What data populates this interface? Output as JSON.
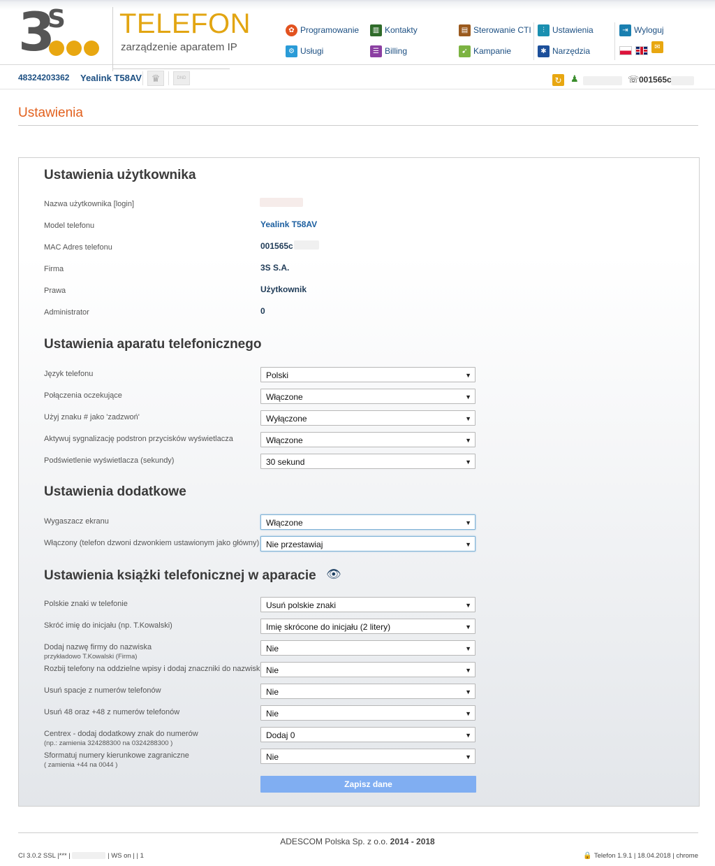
{
  "header": {
    "brand_title": "TELEFON",
    "brand_subtitle": "zarządzenie aparatem IP",
    "nav": {
      "programowanie": "Programowanie",
      "uslugi": "Usługi",
      "kontakty": "Kontakty",
      "billing": "Billing",
      "sterowanie_cti": "Sterowanie CTI",
      "kampanie": "Kampanie",
      "ustawienia": "Ustawienia",
      "narzedzia": "Narzędzia",
      "wyloguj": "Wyloguj"
    },
    "icons": {
      "programowanie": "gear-icon",
      "uslugi": "gear-icon",
      "kontakty": "book-icon",
      "billing": "list-icon",
      "sterowanie_cti": "server-icon",
      "kampanie": "megaphone-icon",
      "ustawienia": "sliders-icon",
      "narzedzia": "tools-icon",
      "wyloguj": "logout-icon"
    },
    "colors": {
      "brand": "#e2a512",
      "nav_link": "#1c4f82"
    }
  },
  "subbar": {
    "phone_number": "48324203362",
    "phone_model": "Yealink T58AV",
    "dnd_label": "DND",
    "mac_prefix": "001565c"
  },
  "page": {
    "title": "Ustawienia",
    "title_color": "#e2611e"
  },
  "user_settings": {
    "title": "Ustawienia użytkownika",
    "rows": [
      {
        "label": "Nazwa użytkownika [login]",
        "value": ""
      },
      {
        "label": "Model telefonu",
        "value": "Yealink T58AV"
      },
      {
        "label": "MAC Adres telefonu",
        "value": "001565c"
      },
      {
        "label": "Firma",
        "value": "3S S.A."
      },
      {
        "label": "Prawa",
        "value": "Użytkownik"
      },
      {
        "label": "Administrator",
        "value": "0"
      }
    ]
  },
  "phone_settings": {
    "title": "Ustawienia aparatu telefonicznego",
    "rows": [
      {
        "label": "Język telefonu",
        "value": "Polski"
      },
      {
        "label": "Połączenia oczekujące",
        "value": "Włączone"
      },
      {
        "label": "Użyj znaku # jako 'zadzwoń'",
        "value": "Wyłączone"
      },
      {
        "label": "Aktywuj sygnalizację podstron przycisków wyświetlacza",
        "value": "Włączone"
      },
      {
        "label": "Podświetlenie wyświetlacza (sekundy)",
        "value": "30 sekund"
      }
    ]
  },
  "extra_settings": {
    "title": "Ustawienia dodatkowe",
    "rows": [
      {
        "label": "Wygaszacz ekranu",
        "value": "Włączone"
      },
      {
        "label": "Włączony (telefon dzwoni dzwonkiem ustawionym jako główny)",
        "value": "Nie przestawiaj"
      }
    ]
  },
  "phonebook_settings": {
    "title": "Ustawienia książki telefonicznej w aparacie",
    "rows": [
      {
        "label": "Polskie znaki w telefonie",
        "sublabel": "",
        "value": "Usuń polskie znaki"
      },
      {
        "label": "Skróć imię do inicjału (np. T.Kowalski)",
        "sublabel": "",
        "value": "Imię skrócone do inicjału (2 litery)"
      },
      {
        "label": "Dodaj nazwę firmy do nazwiska",
        "sublabel": "przykładowo T.Kowalski (Firma)",
        "value": "Nie"
      },
      {
        "label": "Rozbij telefony na oddzielne wpisy i dodaj znaczniki do nazwisk",
        "sublabel": "",
        "value": "Nie"
      },
      {
        "label": "Usuń spacje z numerów telefonów",
        "sublabel": "",
        "value": "Nie"
      },
      {
        "label": "Usuń 48 oraz +48 z numerów telefonów",
        "sublabel": "",
        "value": "Nie"
      },
      {
        "label": "Centrex - dodaj dodatkowy znak do numerów",
        "sublabel": "(np.: zamienia 324288300 na 0324288300 )",
        "value": "Dodaj 0"
      },
      {
        "label": "Sformatuj numery kierunkowe zagraniczne",
        "sublabel": "( zamienia +44 na 0044 )",
        "value": "Nie"
      }
    ]
  },
  "actions": {
    "save_label": "Zapisz dane",
    "save_color": "#80aef2"
  },
  "footer": {
    "company": "ADESCOM Polska Sp. z o.o.",
    "years": "2014 - 2018",
    "left_a": "CI 3.0.2 SSL |*** |",
    "left_b": "| WS on | | 1",
    "right": "Telefon 1.9.1 | 18.04.2018 | chrome"
  }
}
